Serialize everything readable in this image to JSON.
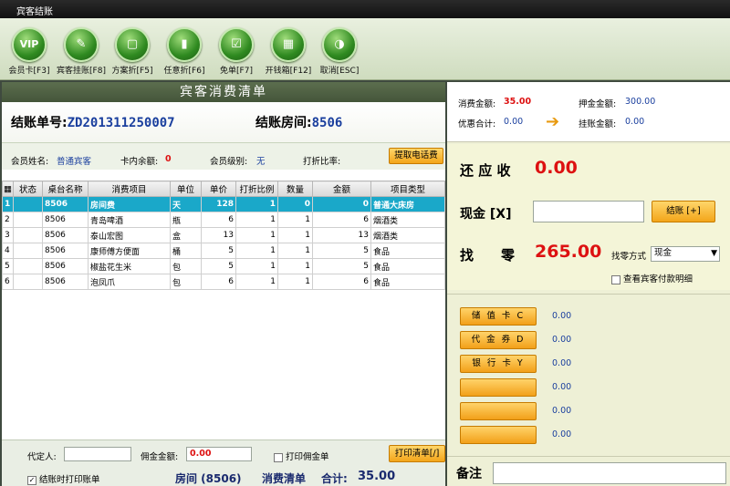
{
  "window": {
    "title": "宾客结账"
  },
  "toolbar": {
    "buttons": [
      {
        "label": "会员卡[F3]",
        "icon": "VIP"
      },
      {
        "label": "宾客挂账[F8]",
        "icon": "✎"
      },
      {
        "label": "方案折[F5]",
        "icon": "▢"
      },
      {
        "label": "任意折[F6]",
        "icon": "▮"
      },
      {
        "label": "免单[F7]",
        "icon": "☑"
      },
      {
        "label": "开钱箱[F12]",
        "icon": "▦"
      },
      {
        "label": "取消[ESC]",
        "icon": "◑"
      }
    ]
  },
  "bill": {
    "header": "宾客消费清单",
    "bill_no_label": "结账单号:",
    "bill_no": "ZD201311250007",
    "room_label": "结账房间:",
    "room": "8506"
  },
  "member": {
    "name_label": "会员姓名:",
    "name": "普通宾客",
    "balance_label": "卡内余额:",
    "balance": "0",
    "level_label": "会员级别:",
    "level": "无",
    "discount_label": "打折比率:",
    "phone_btn": "提取电话费"
  },
  "table": {
    "columns": [
      "状态",
      "桌台名称",
      "消费项目",
      "单位",
      "单价",
      "打折比例",
      "数量",
      "金额",
      "项目类型"
    ],
    "rows": [
      {
        "no": "1",
        "status": "",
        "room": "8506",
        "item": "房间费",
        "unit": "天",
        "price": "128",
        "disc": "1",
        "qty": "0",
        "amount": "0",
        "type": "普通大床房"
      },
      {
        "no": "2",
        "status": "",
        "room": "8506",
        "item": "青岛啤酒",
        "unit": "瓶",
        "price": "6",
        "disc": "1",
        "qty": "1",
        "amount": "6",
        "type": "烟酒类"
      },
      {
        "no": "3",
        "status": "",
        "room": "8506",
        "item": "泰山宏图",
        "unit": "盒",
        "price": "13",
        "disc": "1",
        "qty": "1",
        "amount": "13",
        "type": "烟酒类"
      },
      {
        "no": "4",
        "status": "",
        "room": "8506",
        "item": "康师傅方便面",
        "unit": "桶",
        "price": "5",
        "disc": "1",
        "qty": "1",
        "amount": "5",
        "type": "食品"
      },
      {
        "no": "5",
        "status": "",
        "room": "8506",
        "item": "椒盐花生米",
        "unit": "包",
        "price": "5",
        "disc": "1",
        "qty": "1",
        "amount": "5",
        "type": "食品"
      },
      {
        "no": "6",
        "status": "",
        "room": "8506",
        "item": "泡凤爪",
        "unit": "包",
        "price": "6",
        "disc": "1",
        "qty": "1",
        "amount": "6",
        "type": "食品"
      }
    ]
  },
  "footer": {
    "agent_label": "代定人:",
    "agent_value": "",
    "commission_label": "佣金金额:",
    "commission_value": "0.00",
    "print_commission": "打印佣金单",
    "print_list_btn": "打印清单[/]",
    "print_on_checkout": "结账时打印账单",
    "summary_room": "房间 (8506)",
    "summary_list": "消费清单",
    "summary_total_label": "合计:",
    "summary_total": "35.00"
  },
  "summary": {
    "consume_label": "消费金额:",
    "consume": "35.00",
    "deposit_label": "押金金额:",
    "deposit": "300.00",
    "discount_label": "优惠合计:",
    "discount": "0.00",
    "credit_label": "挂账金额:",
    "credit": "0.00"
  },
  "payment": {
    "due_label": "还 应 收",
    "due": "0.00",
    "cash_label": "现金 [X]",
    "cash_value": "",
    "checkout_btn": "结账 [+]",
    "change_label": "找　　零",
    "change": "265.00",
    "change_method_label": "找零方式",
    "change_method": "现金",
    "view_detail": "查看宾客付款明细"
  },
  "cards": [
    {
      "label": "储 值 卡 C",
      "value": "0.00"
    },
    {
      "label": "代 金 券 D",
      "value": "0.00"
    },
    {
      "label": "银 行 卡 Y",
      "value": "0.00"
    },
    {
      "label": "",
      "value": "0.00"
    },
    {
      "label": "",
      "value": "0.00"
    },
    {
      "label": "",
      "value": "0.00"
    }
  ],
  "note": {
    "label": "备注",
    "value": ""
  },
  "colors": {
    "accent_red": "#dd1111",
    "selected_row": "#1aa8c9",
    "button_orange": "#f3a51a"
  }
}
